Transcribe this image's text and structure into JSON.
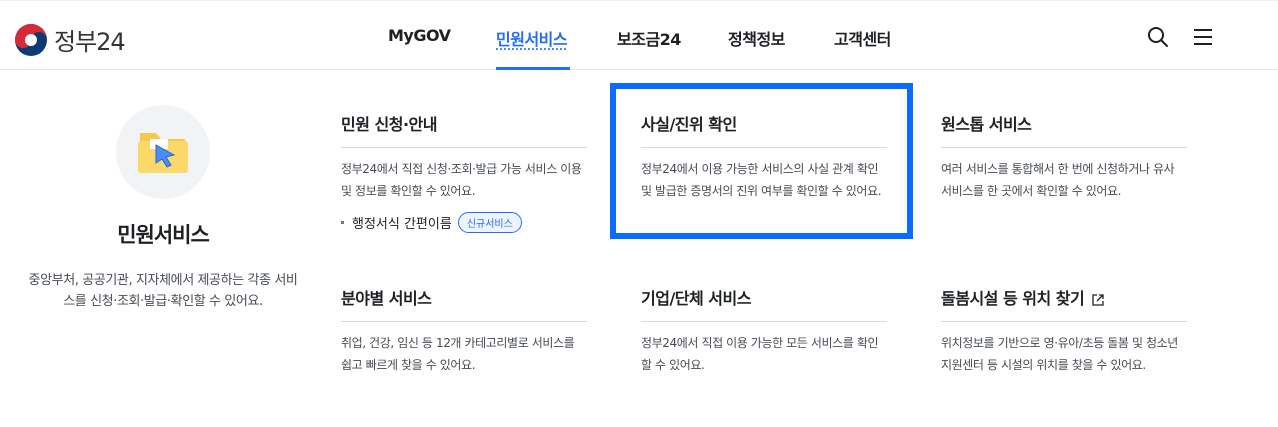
{
  "header": {
    "logo_text": "정부24",
    "nav": [
      "MyGOV",
      "민원서비스",
      "보조금24",
      "정책정보",
      "고객센터"
    ],
    "active_nav": "민원서비스",
    "icons": [
      "search-icon",
      "menu-icon"
    ]
  },
  "intro": {
    "icon": "folder-cursor-icon",
    "title": "민원서비스",
    "description": "중앙부처, 공공기관, 지자체에서 제공하는 각종 서비스를 신청·조회·발급·확인할 수 있어요."
  },
  "cards": [
    {
      "title": "민원 신청·안내",
      "description": "정부24에서 직접 신청·조회·발급 가능 서비스 이용 및 정보를 확인할 수 있어요.",
      "link": "행정서식 간편이름",
      "badge": "신규서비스"
    },
    {
      "title": "사실/진위 확인",
      "description": "정부24에서 이용 가능한 서비스의 사실 관계 확인 및 발급한 증명서의 진위 여부를 확인할 수 있어요."
    },
    {
      "title": "원스톱 서비스",
      "description": "여러 서비스를 통합해서 한 번에 신청하거나 유사 서비스를 한 곳에서 확인할 수 있어요."
    },
    {
      "title": "분야별 서비스",
      "description": "취업, 건강, 임신 등 12개 카테고리별로 서비스를 쉽고 빠르게 찾을 수 있어요."
    },
    {
      "title": "기업/단체 서비스",
      "description": "정부24에서 직접 이용 가능한 모든 서비스를 확인할 수 있어요."
    },
    {
      "title": "돌봄시설 등 위치 찾기",
      "description": "위치정보를 기반으로 영·유아/초등 돌봄 및 청소년 지원센터 등 시설의 위치를 찾을 수 있어요.",
      "icon": "external-link-icon"
    }
  ],
  "colors": {
    "accent": "#256ef4",
    "highlight": "#0a6cff"
  }
}
